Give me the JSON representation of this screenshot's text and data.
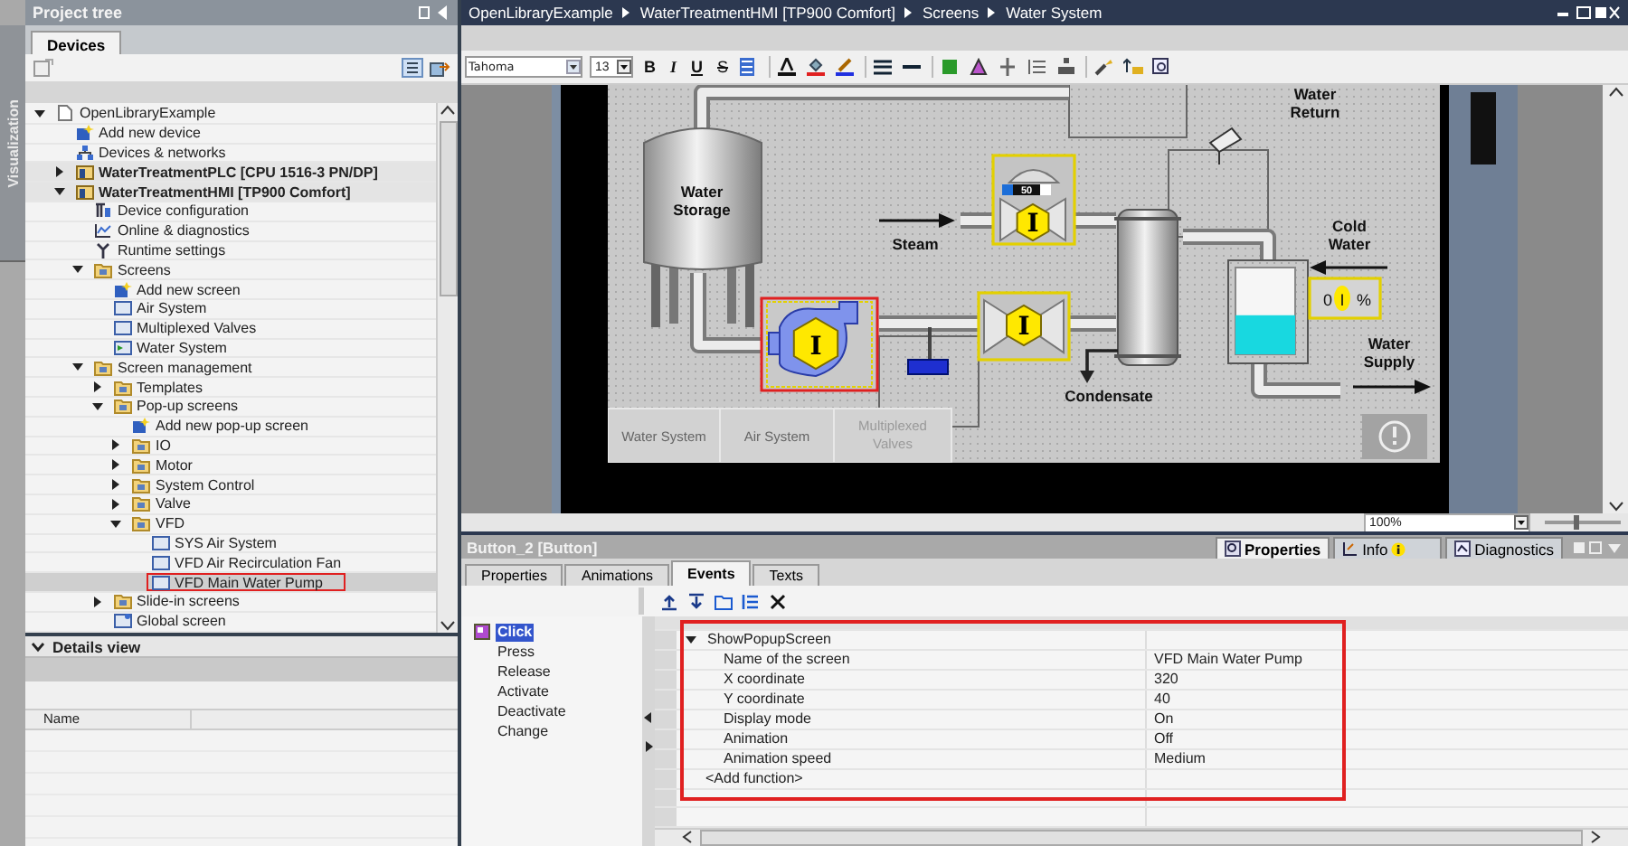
{
  "side_strip": {
    "label": "Visualization"
  },
  "project_tree": {
    "title": "Project tree",
    "tabs": [
      {
        "label": "Devices",
        "selected": true
      }
    ],
    "items": [
      {
        "label": "OpenLibraryExample",
        "kind": "project",
        "selected": false,
        "highlighted": false,
        "expanded": true,
        "children": [
          {
            "label": "Add new device",
            "kind": "add",
            "selected": false,
            "highlighted": false
          },
          {
            "label": "Devices & networks",
            "kind": "network",
            "selected": false,
            "highlighted": false
          },
          {
            "label": "WaterTreatmentPLC [CPU 1516-3 PN/DP]",
            "kind": "device",
            "selected": false,
            "highlighted": false,
            "expanded": false
          },
          {
            "label": "WaterTreatmentHMI [TP900 Comfort]",
            "kind": "device",
            "selected": false,
            "highlighted": false,
            "expanded": true,
            "children": [
              {
                "label": "Device configuration",
                "kind": "config",
                "selected": false,
                "highlighted": false
              },
              {
                "label": "Online & diagnostics",
                "kind": "online",
                "selected": false,
                "highlighted": false
              },
              {
                "label": "Runtime settings",
                "kind": "settings",
                "selected": false,
                "highlighted": false
              },
              {
                "label": "Screens",
                "kind": "folder",
                "selected": false,
                "highlighted": false,
                "expanded": true,
                "children": [
                  {
                    "label": "Add new screen",
                    "kind": "add",
                    "selected": false,
                    "highlighted": false
                  },
                  {
                    "label": "Air System",
                    "kind": "screen",
                    "selected": false,
                    "highlighted": false
                  },
                  {
                    "label": "Multiplexed Valves",
                    "kind": "screen",
                    "selected": false,
                    "highlighted": false
                  },
                  {
                    "label": "Water System",
                    "kind": "start",
                    "selected": false,
                    "highlighted": false
                  }
                ]
              },
              {
                "label": "Screen management",
                "kind": "folder",
                "selected": false,
                "highlighted": false,
                "expanded": true,
                "children": [
                  {
                    "label": "Templates",
                    "kind": "folder",
                    "selected": false,
                    "highlighted": false,
                    "expanded": false
                  },
                  {
                    "label": "Pop-up screens",
                    "kind": "folder",
                    "selected": false,
                    "highlighted": false,
                    "expanded": true,
                    "children": [
                      {
                        "label": "Add new pop-up screen",
                        "kind": "add",
                        "selected": false,
                        "highlighted": false
                      },
                      {
                        "label": "IO",
                        "kind": "folder",
                        "selected": false,
                        "highlighted": false,
                        "expanded": false
                      },
                      {
                        "label": "Motor",
                        "kind": "folder",
                        "selected": false,
                        "highlighted": false,
                        "expanded": false
                      },
                      {
                        "label": "System Control",
                        "kind": "folder",
                        "selected": false,
                        "highlighted": false,
                        "expanded": false
                      },
                      {
                        "label": "Valve",
                        "kind": "folder",
                        "selected": false,
                        "highlighted": false,
                        "expanded": false
                      },
                      {
                        "label": "VFD",
                        "kind": "folder",
                        "selected": false,
                        "highlighted": false,
                        "expanded": true,
                        "children": [
                          {
                            "label": "SYS Air System",
                            "kind": "screen",
                            "selected": false,
                            "highlighted": false
                          },
                          {
                            "label": "VFD Air Recirculation Fan",
                            "kind": "screen",
                            "selected": false,
                            "highlighted": false
                          },
                          {
                            "label": "VFD Main Water Pump",
                            "kind": "screen",
                            "selected": true,
                            "highlighted": true
                          }
                        ]
                      }
                    ]
                  },
                  {
                    "label": "Slide-in screens",
                    "kind": "folder",
                    "selected": false,
                    "highlighted": false,
                    "expanded": false
                  },
                  {
                    "label": "Global screen",
                    "kind": "global",
                    "selected": false,
                    "highlighted": false
                  }
                ]
              }
            ]
          }
        ]
      }
    ]
  },
  "details_view": {
    "title": "Details view",
    "expanded": true,
    "columns": [
      "Name"
    ]
  },
  "editor": {
    "breadcrumb": [
      "OpenLibraryExample",
      "WaterTreatmentHMI [TP900 Comfort]",
      "Screens",
      "Water System"
    ],
    "font": "Tahoma",
    "font_size": "13",
    "format_buttons": [
      "B",
      "I",
      "U",
      "S"
    ],
    "zoom": "100%",
    "zoom_slider": {
      "level": 0.4
    }
  },
  "hmi_screen": {
    "storage_label": [
      "Water",
      "Storage"
    ],
    "steam_label": "Steam",
    "return_label": [
      "Water",
      "Return"
    ],
    "cold_label": [
      "Cold",
      "Water"
    ],
    "condensate_label": "Condensate",
    "supply_label": [
      "Water",
      "Supply"
    ],
    "faceplates": [
      {
        "kind": "pump",
        "symbol": "I",
        "selected": true
      },
      {
        "kind": "valve-display",
        "symbol": "I",
        "display": "50",
        "selected": false
      },
      {
        "kind": "valve",
        "symbol": "I",
        "selected": false
      }
    ],
    "tank": {
      "level": 0.45
    },
    "readout": {
      "value": "0",
      "symbol": "I",
      "unit": "%"
    },
    "nav_buttons": [
      {
        "lines": [
          "Water System"
        ],
        "disabled": false
      },
      {
        "lines": [
          "Air System"
        ],
        "disabled": false
      },
      {
        "lines": [
          "Multiplexed",
          "Valves"
        ],
        "disabled": true
      }
    ]
  },
  "inspector": {
    "title": "Button_2 [Button]",
    "tabs": [
      {
        "label": "Properties",
        "selected": true
      },
      {
        "label": "Info",
        "selected": false
      },
      {
        "label": "Diagnostics",
        "selected": false
      }
    ],
    "subtabs": [
      {
        "label": "Properties",
        "selected": false
      },
      {
        "label": "Animations",
        "selected": false
      },
      {
        "label": "Events",
        "selected": true
      },
      {
        "label": "Texts",
        "selected": false
      }
    ],
    "events": [
      {
        "label": "Click",
        "selected": true
      },
      {
        "label": "Press",
        "selected": false
      },
      {
        "label": "Release",
        "selected": false
      },
      {
        "label": "Activate",
        "selected": false
      },
      {
        "label": "Deactivate",
        "selected": false
      },
      {
        "label": "Change",
        "selected": false
      }
    ],
    "function": {
      "name": "ShowPopupScreen",
      "expanded": true,
      "highlighted": true,
      "parameters": [
        {
          "name": "Name of the screen",
          "value": "VFD Main Water Pump"
        },
        {
          "name": "X coordinate",
          "value": "320"
        },
        {
          "name": "Y coordinate",
          "value": "40"
        },
        {
          "name": "Display mode",
          "value": "On"
        },
        {
          "name": "Animation",
          "value": "Off"
        },
        {
          "name": "Animation speed",
          "value": "Medium"
        }
      ],
      "add_label": "<Add function>"
    }
  }
}
